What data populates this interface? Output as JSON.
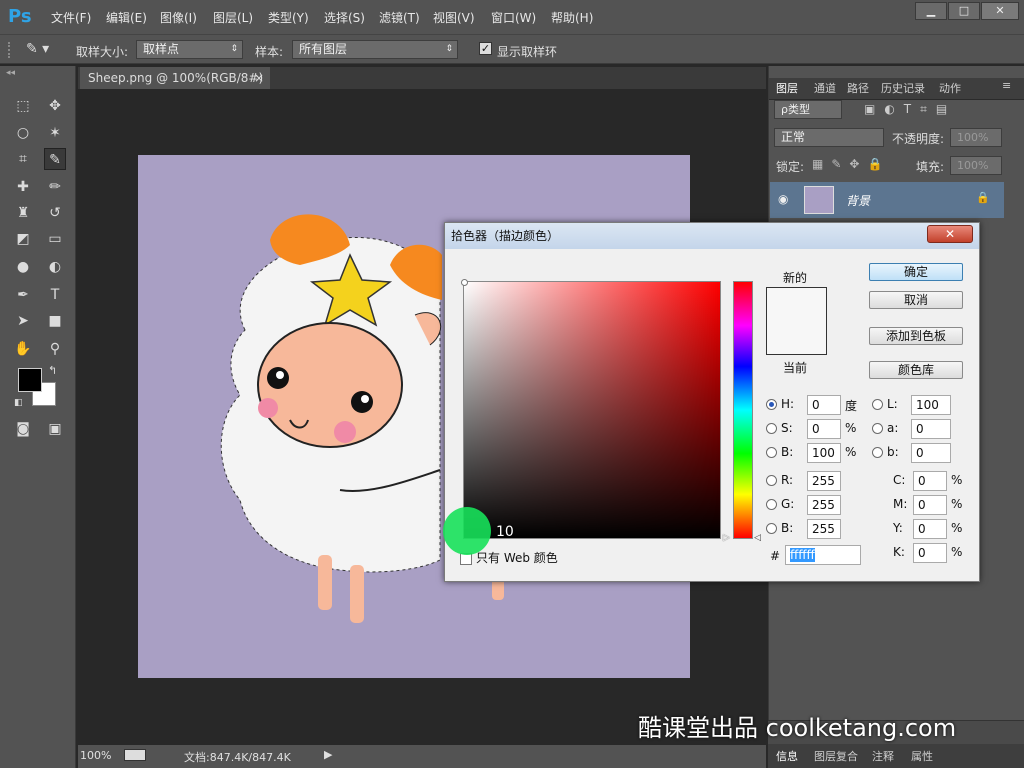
{
  "app": {
    "logo": "Ps"
  },
  "menu": [
    {
      "label": "文件(F)"
    },
    {
      "label": "编辑(E)"
    },
    {
      "label": "图像(I)"
    },
    {
      "label": "图层(L)"
    },
    {
      "label": "类型(Y)"
    },
    {
      "label": "选择(S)"
    },
    {
      "label": "滤镜(T)"
    },
    {
      "label": "视图(V)"
    },
    {
      "label": "窗口(W)"
    },
    {
      "label": "帮助(H)"
    }
  ],
  "window_controls": {
    "minimize": "▁",
    "maximize": "□",
    "close": "✕"
  },
  "options_bar": {
    "sample_size_label": "取样大小:",
    "sample_size_value": "取样点",
    "sample_label": "样本:",
    "sample_value": "所有图层",
    "show_ring_label": "显示取样环",
    "show_ring_checked": true
  },
  "document": {
    "tab_title": "Sheep.png @ 100%(RGB/8#) *",
    "zoom": "100%",
    "doc_info": "文档:847.4K/847.4K",
    "canvas_color": "#a99fc4"
  },
  "layers_panel": {
    "tabs": [
      "图层",
      "通道",
      "路径",
      "历史记录",
      "动作"
    ],
    "filter_label": "ρ类型",
    "blend_mode": "正常",
    "opacity_label": "不透明度:",
    "opacity_value": "100%",
    "lock_label": "锁定:",
    "fill_label": "填充:",
    "fill_value": "100%",
    "layer_name": "背景",
    "bottom_tabs": [
      "信息",
      "图层复合",
      "注释",
      "属性"
    ]
  },
  "color_picker": {
    "title": "拾色器（描边颜色）",
    "new_label": "新的",
    "current_label": "当前",
    "ok": "确定",
    "cancel": "取消",
    "add_swatch": "添加到色板",
    "libraries": "颜色库",
    "only_web": "只有 Web 颜色",
    "hash": "#",
    "hex": "ffffff",
    "selected_color": "#ffffff",
    "hsb": [
      {
        "label": "H:",
        "value": "0",
        "unit": "度",
        "selected": true
      },
      {
        "label": "S:",
        "value": "0",
        "unit": "%"
      },
      {
        "label": "B:",
        "value": "100",
        "unit": "%"
      }
    ],
    "rgb": [
      {
        "label": "R:",
        "value": "255"
      },
      {
        "label": "G:",
        "value": "255"
      },
      {
        "label": "B:",
        "value": "255"
      }
    ],
    "lab": [
      {
        "label": "L:",
        "value": "100"
      },
      {
        "label": "a:",
        "value": "0"
      },
      {
        "label": "b:",
        "value": "0"
      }
    ],
    "cmyk": [
      {
        "label": "C:",
        "value": "0",
        "unit": "%"
      },
      {
        "label": "M:",
        "value": "0",
        "unit": "%"
      },
      {
        "label": "Y:",
        "value": "0",
        "unit": "%"
      },
      {
        "label": "K:",
        "value": "0",
        "unit": "%"
      }
    ]
  },
  "cursor_badge": "10",
  "watermark": "酷课堂出品 coolketang.com"
}
